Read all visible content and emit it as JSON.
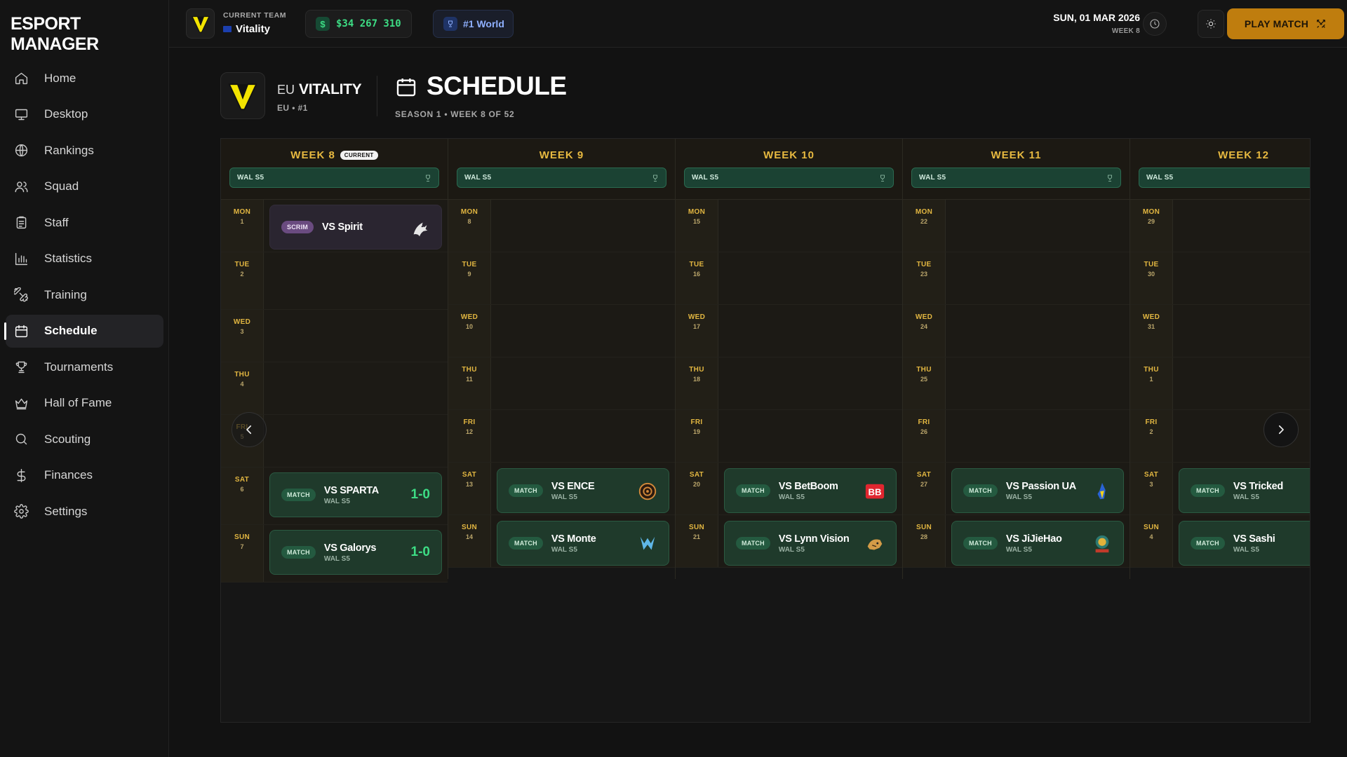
{
  "brand": "ESPORT MANAGER",
  "nav": [
    {
      "label": "Home",
      "icon": "home-icon"
    },
    {
      "label": "Desktop",
      "icon": "monitor-icon"
    },
    {
      "label": "Rankings",
      "icon": "globe-icon"
    },
    {
      "label": "Squad",
      "icon": "users-icon"
    },
    {
      "label": "Staff",
      "icon": "clipboard-icon"
    },
    {
      "label": "Statistics",
      "icon": "bar-chart-icon"
    },
    {
      "label": "Training",
      "icon": "dumbbell-icon"
    },
    {
      "label": "Schedule",
      "icon": "calendar-icon",
      "active": true
    },
    {
      "label": "Tournaments",
      "icon": "trophy-icon"
    },
    {
      "label": "Hall of Fame",
      "icon": "crown-icon"
    },
    {
      "label": "Scouting",
      "icon": "search-icon"
    },
    {
      "label": "Finances",
      "icon": "dollar-icon"
    },
    {
      "label": "Settings",
      "icon": "gear-icon"
    }
  ],
  "topbar": {
    "current_team_label": "CURRENT TEAM",
    "current_team_name": "Vitality",
    "money": "$34 267 310",
    "rank": "#1 World",
    "date": "SUN, 01 MAR 2026",
    "week": "WEEK 8",
    "play_label": "PLAY MATCH"
  },
  "header": {
    "region": "EU",
    "team_name": "VITALITY",
    "team_sub": "EU • #1",
    "title": "SCHEDULE",
    "subtitle": "SEASON 1 • WEEK 8 OF 52"
  },
  "current_badge": "CURRENT",
  "weeks": [
    {
      "title": "WEEK 8",
      "current": true,
      "tournament": "WAL S5",
      "days": [
        {
          "d": "MON",
          "n": "1",
          "event": {
            "type": "SCRIM",
            "opp": "VS Spirit",
            "logo": "dragon"
          }
        },
        {
          "d": "TUE",
          "n": "2"
        },
        {
          "d": "WED",
          "n": "3"
        },
        {
          "d": "THU",
          "n": "4"
        },
        {
          "d": "FRI",
          "n": "5"
        },
        {
          "d": "SAT",
          "n": "6",
          "event": {
            "type": "MATCH",
            "opp": "VS SPARTA",
            "league": "WAL S5",
            "result": "1-0"
          }
        },
        {
          "d": "SUN",
          "n": "7",
          "event": {
            "type": "MATCH",
            "opp": "VS Galorys",
            "league": "WAL S5",
            "result": "1-0"
          }
        }
      ]
    },
    {
      "title": "WEEK 9",
      "tournament": "WAL S5",
      "days": [
        {
          "d": "MON",
          "n": "8"
        },
        {
          "d": "TUE",
          "n": "9"
        },
        {
          "d": "WED",
          "n": "10"
        },
        {
          "d": "THU",
          "n": "11"
        },
        {
          "d": "FRI",
          "n": "12"
        },
        {
          "d": "SAT",
          "n": "13",
          "event": {
            "type": "MATCH",
            "opp": "VS ENCE",
            "league": "WAL S5",
            "logo": "ence"
          }
        },
        {
          "d": "SUN",
          "n": "14",
          "event": {
            "type": "MATCH",
            "opp": "VS Monte",
            "league": "WAL S5",
            "logo": "monte"
          }
        }
      ]
    },
    {
      "title": "WEEK 10",
      "tournament": "WAL S5",
      "days": [
        {
          "d": "MON",
          "n": "15"
        },
        {
          "d": "TUE",
          "n": "16"
        },
        {
          "d": "WED",
          "n": "17"
        },
        {
          "d": "THU",
          "n": "18"
        },
        {
          "d": "FRI",
          "n": "19"
        },
        {
          "d": "SAT",
          "n": "20",
          "event": {
            "type": "MATCH",
            "opp": "VS BetBoom",
            "league": "WAL S5",
            "logo": "betboom"
          }
        },
        {
          "d": "SUN",
          "n": "21",
          "event": {
            "type": "MATCH",
            "opp": "VS Lynn Vision",
            "league": "WAL S5",
            "logo": "lynn"
          }
        }
      ]
    },
    {
      "title": "WEEK 11",
      "tournament": "WAL S5",
      "days": [
        {
          "d": "MON",
          "n": "22"
        },
        {
          "d": "TUE",
          "n": "23"
        },
        {
          "d": "WED",
          "n": "24"
        },
        {
          "d": "THU",
          "n": "25"
        },
        {
          "d": "FRI",
          "n": "26"
        },
        {
          "d": "SAT",
          "n": "27",
          "event": {
            "type": "MATCH",
            "opp": "VS Passion UA",
            "league": "WAL S5",
            "logo": "passion"
          }
        },
        {
          "d": "SUN",
          "n": "28",
          "event": {
            "type": "MATCH",
            "opp": "VS JiJieHao",
            "league": "WAL S5",
            "logo": "jijiehao"
          }
        }
      ]
    },
    {
      "title": "WEEK 12",
      "tournament": "WAL S5",
      "days": [
        {
          "d": "MON",
          "n": "29"
        },
        {
          "d": "TUE",
          "n": "30"
        },
        {
          "d": "WED",
          "n": "31"
        },
        {
          "d": "THU",
          "n": "1"
        },
        {
          "d": "FRI",
          "n": "2"
        },
        {
          "d": "SAT",
          "n": "3",
          "event": {
            "type": "MATCH",
            "opp": "VS Tricked",
            "league": "WAL S5"
          }
        },
        {
          "d": "SUN",
          "n": "4",
          "event": {
            "type": "MATCH",
            "opp": "VS Sashi",
            "league": "WAL S5"
          }
        }
      ]
    }
  ],
  "colors": {
    "accent": "#e7b940",
    "match_green": "#3ddc84",
    "play_button": "#bf7d0e"
  }
}
